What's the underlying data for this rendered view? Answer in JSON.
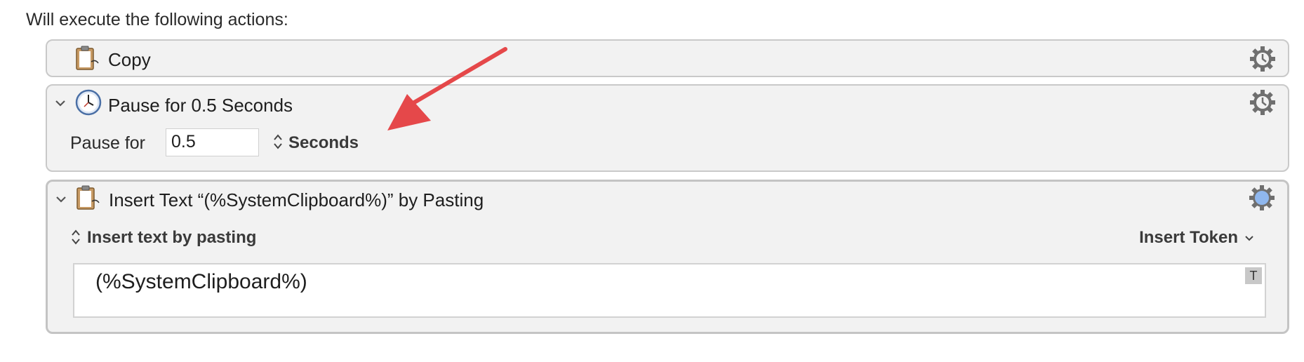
{
  "header": {
    "text": "Will execute the following actions:"
  },
  "actions": {
    "copy": {
      "title": "Copy",
      "icon": "clipboard-icon"
    },
    "pause": {
      "title": "Pause for 0.5 Seconds",
      "icon": "clock-icon",
      "pause_label": "Pause for",
      "value": "0.5",
      "unit": "Seconds"
    },
    "insert": {
      "title": "Insert Text “(%SystemClipboard%)” by Pasting",
      "icon": "clipboard-icon",
      "mode": "Insert text by pasting",
      "token_menu": "Insert Token",
      "text": "(%SystemClipboard%)",
      "badge": "T"
    }
  },
  "colors": {
    "accent_arrow": "#e5484a",
    "active_gear": "#8fb7ee",
    "gear": "#6f6f6f"
  }
}
